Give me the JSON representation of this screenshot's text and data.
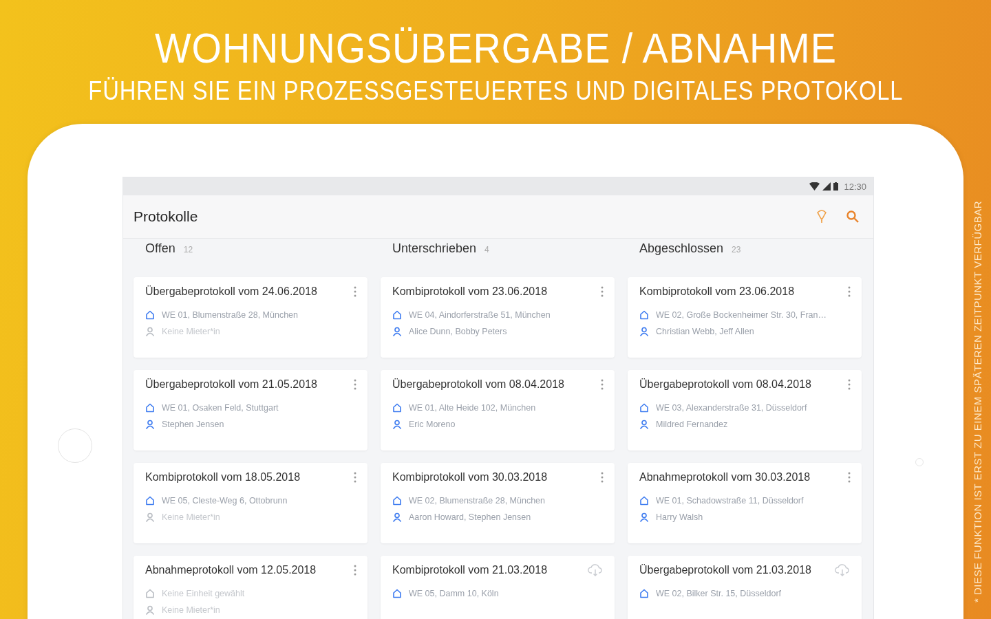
{
  "headline": "WOHNUNGSÜBERGABE / ABNAHME",
  "subheadline": "FÜHREN SIE EIN PROZESSGESTEUERTES UND DIGITALES PROTOKOLL",
  "side_note": "* DIESE FUNKTION IST ERST ZU EINEM SPÄTEREN ZEITPUNKT VERFÜGBAR",
  "status_bar": {
    "time": "12:30"
  },
  "app_bar": {
    "title": "Protokolle"
  },
  "columns": [
    {
      "title": "Offen",
      "count": "12",
      "cards": [
        {
          "title": "Übergabeprotokoll vom 24.06.2018",
          "kind": "menu",
          "unit": "WE 01, Blumenstraße 28, München",
          "unit_set": true,
          "tenant": "Keine Mieter*in",
          "tenant_set": false
        },
        {
          "title": "Übergabeprotokoll vom 21.05.2018",
          "kind": "menu",
          "unit": "WE 01, Osaken Feld, Stuttgart",
          "unit_set": true,
          "tenant": "Stephen Jensen",
          "tenant_set": true
        },
        {
          "title": "Kombiprotokoll vom 18.05.2018",
          "kind": "menu",
          "unit": "WE 05, Cleste-Weg 6, Ottobrunn",
          "unit_set": true,
          "tenant": "Keine Mieter*in",
          "tenant_set": false
        },
        {
          "title": "Abnahmeprotokoll vom 12.05.2018",
          "kind": "menu",
          "unit": "Keine Einheit gewählt",
          "unit_set": false,
          "tenant": "Keine Mieter*in",
          "tenant_set": false
        }
      ]
    },
    {
      "title": "Unterschrieben",
      "count": "4",
      "cards": [
        {
          "title": "Kombiprotokoll vom 23.06.2018",
          "kind": "menu",
          "unit": "WE 04, Aindorferstraße 51, München",
          "unit_set": true,
          "tenant": "Alice Dunn, Bobby Peters",
          "tenant_set": true
        },
        {
          "title": "Übergabeprotokoll vom 08.04.2018",
          "kind": "menu",
          "unit": "WE 01, Alte Heide 102, München",
          "unit_set": true,
          "tenant": "Eric Moreno",
          "tenant_set": true
        },
        {
          "title": "Kombiprotokoll vom 30.03.2018",
          "kind": "menu",
          "unit": "WE 02, Blumenstraße 28, München",
          "unit_set": true,
          "tenant": "Aaron Howard, Stephen Jensen",
          "tenant_set": true
        },
        {
          "title": "Kombiprotokoll vom 21.03.2018",
          "kind": "cloud",
          "unit": "WE 05, Damm 10, Köln",
          "unit_set": true
        }
      ]
    },
    {
      "title": "Abgeschlossen",
      "count": "23",
      "cards": [
        {
          "title": "Kombiprotokoll vom 23.06.2018",
          "kind": "menu",
          "unit": "WE 02, Große Bockenheimer Str. 30, Fran…",
          "unit_set": true,
          "tenant": "Christian Webb, Jeff Allen",
          "tenant_set": true
        },
        {
          "title": "Übergabeprotokoll vom 08.04.2018",
          "kind": "menu",
          "unit": "WE 03, Alexanderstraße 31, Düsseldorf",
          "unit_set": true,
          "tenant": "Mildred Fernandez",
          "tenant_set": true
        },
        {
          "title": "Abnahmeprotokoll vom 30.03.2018",
          "kind": "menu",
          "unit": "WE 01, Schadowstraße 11, Düsseldorf",
          "unit_set": true,
          "tenant": "Harry Walsh",
          "tenant_set": true
        },
        {
          "title": "Übergabeprotokoll vom 21.03.2018",
          "kind": "cloud",
          "unit": "WE 02, Bilker Str. 15, Düsseldorf",
          "unit_set": true
        }
      ]
    }
  ]
}
